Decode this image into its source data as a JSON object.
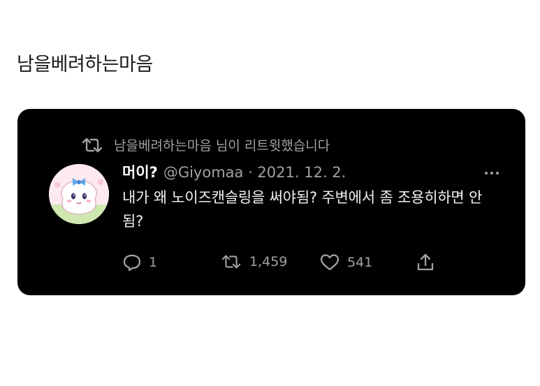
{
  "page": {
    "title": "남을베려하는마음"
  },
  "tweet": {
    "retweet_label": "남을베려하는마음 님이 리트윗했습니다",
    "display_name": "머이?",
    "handle_meta": "@Giyomaa · 2021. 12. 2.",
    "text": "내가 왜 노이즈캔슬링을 써야됨? 주변에서 좀 조용히하면 안 됨?",
    "reply_count": "1",
    "retweet_count": "1,459",
    "like_count": "541"
  },
  "icons": {
    "retweet": "retweet-icon",
    "more": "more-horizontal-icon",
    "reply": "reply-icon",
    "like": "heart-icon",
    "share": "share-icon"
  },
  "colors": {
    "card_background": "#000000",
    "muted_text": "#9ea2a6",
    "body_text": "#f2f2f2"
  }
}
